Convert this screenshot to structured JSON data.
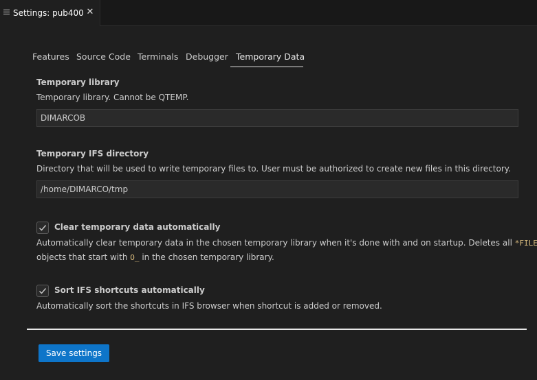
{
  "editor_tab": {
    "icon": "lines-icon",
    "title": "Settings: pub400",
    "close_glyph": "✕"
  },
  "subtabs": [
    {
      "label": "Features",
      "active": false
    },
    {
      "label": "Source Code",
      "active": false
    },
    {
      "label": "Terminals",
      "active": false
    },
    {
      "label": "Debugger",
      "active": false
    },
    {
      "label": "Temporary Data",
      "active": true
    }
  ],
  "temporary_library": {
    "title": "Temporary library",
    "description": "Temporary library. Cannot be QTEMP.",
    "value": "DIMARCOB"
  },
  "temporary_ifs": {
    "title": "Temporary IFS directory",
    "description": "Directory that will be used to write temporary files to. User must be authorized to create new files in this directory.",
    "value": "/home/DIMARCO/tmp"
  },
  "clear_temp": {
    "label": "Clear temporary data automatically",
    "checked": true,
    "desc_part1": "Automatically clear temporary data in the chosen temporary library when it's done with and on startup. Deletes all ",
    "desc_code1": "*FILE",
    "desc_part2": "objects that start with ",
    "desc_code2": "O_",
    "desc_part3": " in the chosen temporary library."
  },
  "sort_ifs": {
    "label": "Sort IFS shortcuts automatically",
    "checked": true,
    "description": "Automatically sort the shortcuts in IFS browser when shortcut is added or removed."
  },
  "save_button": {
    "label": "Save settings"
  },
  "colors": {
    "background": "#1f1f1f",
    "accent_button": "#0e75c9",
    "inline_code": "#d7ba7d"
  }
}
